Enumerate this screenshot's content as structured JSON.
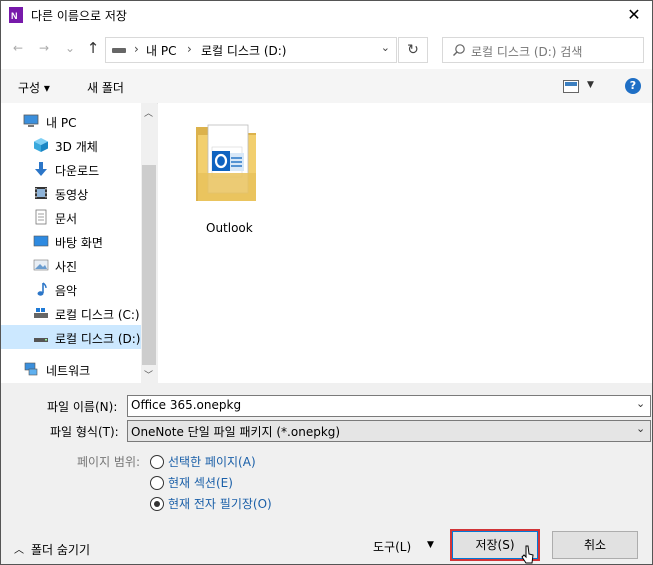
{
  "window": {
    "title": "다른 이름으로 저장",
    "close_glyph": "✕"
  },
  "nav": {
    "back": "←",
    "forward": "→",
    "recent": "⌄",
    "up": "↑",
    "address": {
      "segment1": "내 PC",
      "separator": "›",
      "segment2": "로컬 디스크 (D:)"
    },
    "search_placeholder": "로컬 디스크 (D:) 검색"
  },
  "toolbar": {
    "organize": "구성 ▾",
    "new_folder": "새 폴더",
    "help": "?"
  },
  "sidebar": {
    "items": [
      {
        "label": "내 PC",
        "icon": "pc-icon"
      },
      {
        "label": "3D 개체",
        "icon": "3d-objects-icon"
      },
      {
        "label": "다운로드",
        "icon": "download-icon"
      },
      {
        "label": "동영상",
        "icon": "video-icon"
      },
      {
        "label": "문서",
        "icon": "document-icon"
      },
      {
        "label": "바탕 화면",
        "icon": "desktop-icon"
      },
      {
        "label": "사진",
        "icon": "picture-icon"
      },
      {
        "label": "음악",
        "icon": "music-icon"
      },
      {
        "label": "로컬 디스크 (C:)",
        "icon": "drive-icon"
      },
      {
        "label": "로컬 디스크 (D:)",
        "icon": "drive-icon",
        "selected": true
      },
      {
        "label": "네트워크",
        "icon": "network-icon"
      }
    ]
  },
  "files": [
    {
      "name": "Outlook",
      "icon": "onenote-folder-icon"
    }
  ],
  "form": {
    "filename_label": "파일 이름(N):",
    "filename_value": "Office 365.onepkg",
    "filetype_label": "파일 형식(T):",
    "filetype_value": "OneNote 단일 파일 패키지 (*.onepkg)",
    "range_label": "페이지 범위:",
    "range_options": [
      {
        "label": "선택한 페이지(A)",
        "checked": false
      },
      {
        "label": "현재 섹션(E)",
        "checked": false
      },
      {
        "label": "현재 전자 필기장(O)",
        "checked": true
      }
    ]
  },
  "footer": {
    "hide_folders": "폴더 숨기기",
    "tools": "도구(L)",
    "save": "저장(S)",
    "cancel": "취소"
  },
  "colors": {
    "onenote": "#7719aa",
    "highlight": "#cce8ff",
    "save_outline": "#d13438",
    "link": "#1a5fa8"
  }
}
